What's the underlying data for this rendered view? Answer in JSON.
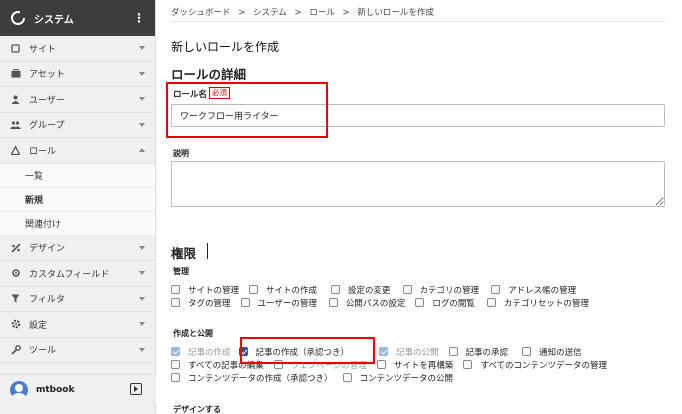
{
  "sidebar": {
    "brand": "システム",
    "items": [
      {
        "label": "サイト",
        "icon": "site-icon"
      },
      {
        "label": "アセット",
        "icon": "asset-icon"
      },
      {
        "label": "ユーザー",
        "icon": "user-icon"
      },
      {
        "label": "グループ",
        "icon": "group-icon"
      },
      {
        "label": "ロール",
        "icon": "role-icon"
      },
      {
        "label": "デザイン",
        "icon": "design-icon"
      },
      {
        "label": "カスタムフィールド",
        "icon": "custom-field-icon"
      },
      {
        "label": "フィルタ",
        "icon": "filter-icon"
      },
      {
        "label": "設定",
        "icon": "settings-icon"
      },
      {
        "label": "ツール",
        "icon": "tools-icon"
      }
    ],
    "role_sub": [
      "一覧",
      "新規",
      "関連付け"
    ],
    "user": "mtbook"
  },
  "breadcrumb": [
    "ダッシュボード",
    ">",
    "システム",
    ">",
    "ロール",
    ">",
    "新しいロールを作成"
  ],
  "page_title": "新しいロールを作成",
  "details": {
    "heading": "ロールの詳細",
    "name_label": "ロール名",
    "required": "必須",
    "name_value": "ワークフロー用ライター",
    "desc_label": "説明"
  },
  "permissions": {
    "heading": "権限",
    "admin_label": "管理",
    "admin_row1": [
      "サイトの管理",
      "サイトの作成",
      "設定の変更",
      "カテゴリの管理",
      "アドレス帳の管理"
    ],
    "admin_row2": [
      "タグの管理",
      "ユーザーの管理",
      "公開パスの設定",
      "ログの閲覧",
      "カテゴリセットの管理"
    ],
    "publish_label": "作成と公開",
    "publish_row1": [
      "記事の作成",
      "記事の作成（承認つき）",
      "記事の公開",
      "記事の承認",
      "通知の送信"
    ],
    "publish_row2": [
      "すべての記事の編集",
      "ウェブページの管理",
      "サイトを再構築",
      "すべてのコンテンツデータの管理"
    ],
    "publish_row3": [
      "コンテンツデータの作成（承認つき）",
      "コンテンツデータの公開"
    ],
    "design_label": "デザインする"
  }
}
